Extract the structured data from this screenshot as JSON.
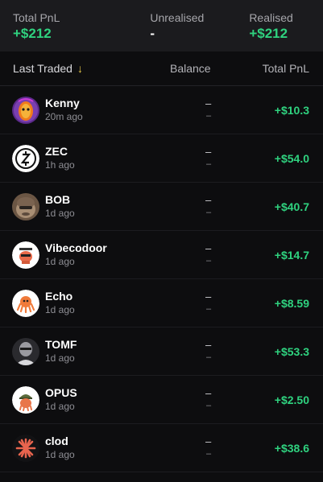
{
  "summary": {
    "total_pnl_label": "Total PnL",
    "total_pnl_value": "+$212",
    "unrealised_label": "Unrealised",
    "unrealised_value": "-",
    "realised_label": "Realised",
    "realised_value": "+$212"
  },
  "header": {
    "last_traded": "Last Traded",
    "sort_icon": "arrow-down-icon",
    "balance": "Balance",
    "total_pnl": "Total PnL"
  },
  "colors": {
    "positive": "#2fd27f",
    "background": "#0d0d0f",
    "panel": "#1b1b1e",
    "sort_arrow": "#e7c84a"
  },
  "rows": [
    {
      "name": "Kenny",
      "time": "20m ago",
      "balance": "–",
      "balance_sub": "–",
      "pnl": "+$10.3",
      "icon": "kenny-avatar-icon"
    },
    {
      "name": "ZEC",
      "time": "1h ago",
      "balance": "–",
      "balance_sub": "–",
      "pnl": "+$54.0",
      "icon": "zec-logo-icon"
    },
    {
      "name": "BOB",
      "time": "1d ago",
      "balance": "–",
      "balance_sub": "–",
      "pnl": "+$40.7",
      "icon": "bob-avatar-icon"
    },
    {
      "name": "Vibecodoor",
      "time": "1d ago",
      "balance": "–",
      "balance_sub": "–",
      "pnl": "+$14.7",
      "icon": "vibecodoor-avatar-icon"
    },
    {
      "name": "Echo",
      "time": "1d ago",
      "balance": "–",
      "balance_sub": "–",
      "pnl": "+$8.59",
      "icon": "echo-avatar-icon"
    },
    {
      "name": "TOMF",
      "time": "1d ago",
      "balance": "–",
      "balance_sub": "–",
      "pnl": "+$53.3",
      "icon": "tomf-avatar-icon"
    },
    {
      "name": "OPUS",
      "time": "1d ago",
      "balance": "–",
      "balance_sub": "–",
      "pnl": "+$2.50",
      "icon": "opus-avatar-icon"
    },
    {
      "name": "clod",
      "time": "1d ago",
      "balance": "–",
      "balance_sub": "–",
      "pnl": "+$38.6",
      "icon": "clod-avatar-icon"
    }
  ]
}
